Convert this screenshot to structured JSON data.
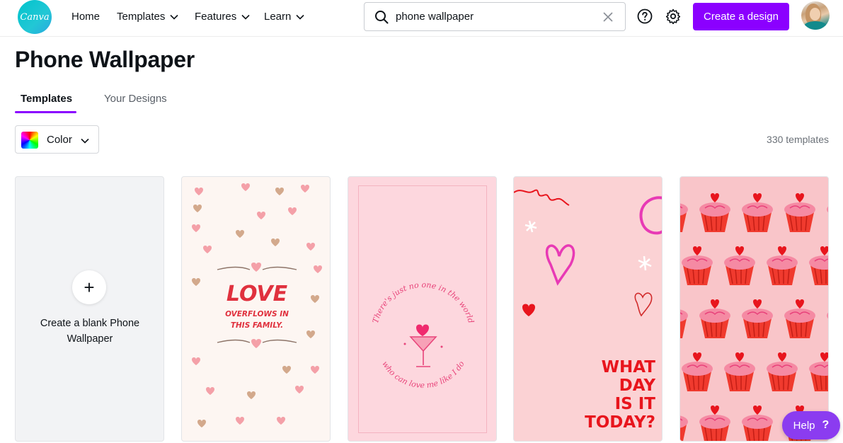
{
  "header": {
    "logo_text": "Canva",
    "nav": [
      {
        "label": "Home"
      },
      {
        "label": "Templates"
      },
      {
        "label": "Features"
      },
      {
        "label": "Learn"
      }
    ],
    "search": {
      "value": "phone wallpaper",
      "placeholder": ""
    },
    "create_label": "Create a design",
    "accent_color": "#8b00ff",
    "icons": [
      "search-icon",
      "clear-icon",
      "help-circle-icon",
      "gear-icon"
    ]
  },
  "main": {
    "title": "Phone Wallpaper",
    "tabs": [
      {
        "label": "Templates",
        "active": true
      },
      {
        "label": "Your Designs",
        "active": false
      }
    ],
    "filter": {
      "label": "Color"
    },
    "count": "330 templates",
    "blank_card": {
      "label": "Create a blank Phone Wallpaper"
    },
    "templates": [
      {
        "lines": [
          "LOVE",
          "OVERFLOWS IN",
          "THIS FAMILY."
        ],
        "bg": "#fdf6f2",
        "accent": "#e0313e"
      },
      {
        "lines": [
          "There's just no one in the world",
          "who can love me like I do"
        ],
        "bg": "#fdd7de",
        "accent": "#e8447a"
      },
      {
        "lines": [
          "WHAT",
          "DAY",
          "IS IT",
          "TODAY?"
        ],
        "bg": "#fbd2d4",
        "accent": "#e8151d"
      },
      {
        "lines": [],
        "bg": "#f9c5c9",
        "accent": "#f03a2e"
      }
    ]
  },
  "help": {
    "label": "Help",
    "icon": "?"
  }
}
